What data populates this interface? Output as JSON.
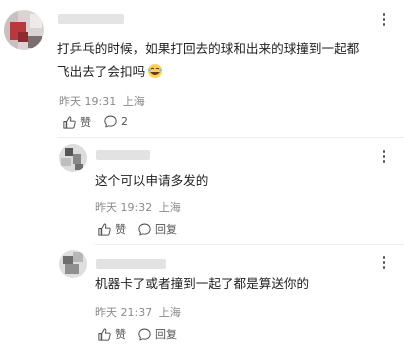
{
  "main_comment": {
    "text_line1": "打乒乓的时候，如果打回去的球和出来的球撞到一起都",
    "text_line2": "飞出去了会扣吗",
    "time": "昨天 19:31",
    "location": "上海",
    "like_label": "赞",
    "reply_count": "2"
  },
  "replies": [
    {
      "text": "这个可以申请多发的",
      "time": "昨天 19:32",
      "location": "上海",
      "like_label": "赞",
      "reply_label": "回复"
    },
    {
      "text": "机器卡了或者撞到一起了都是算送你的",
      "time": "昨天 21:37",
      "location": "上海",
      "like_label": "赞",
      "reply_label": "回复"
    }
  ],
  "icons": {
    "more": "more-vertical-icon",
    "like": "thumbs-up-icon",
    "comment": "comment-bubble-icon",
    "emoji": "laughing-face-icon"
  },
  "colors": {
    "text": "#222222",
    "meta": "#8a8a8a",
    "background": "#ffffff",
    "avatar_accent": "#b8383e"
  }
}
